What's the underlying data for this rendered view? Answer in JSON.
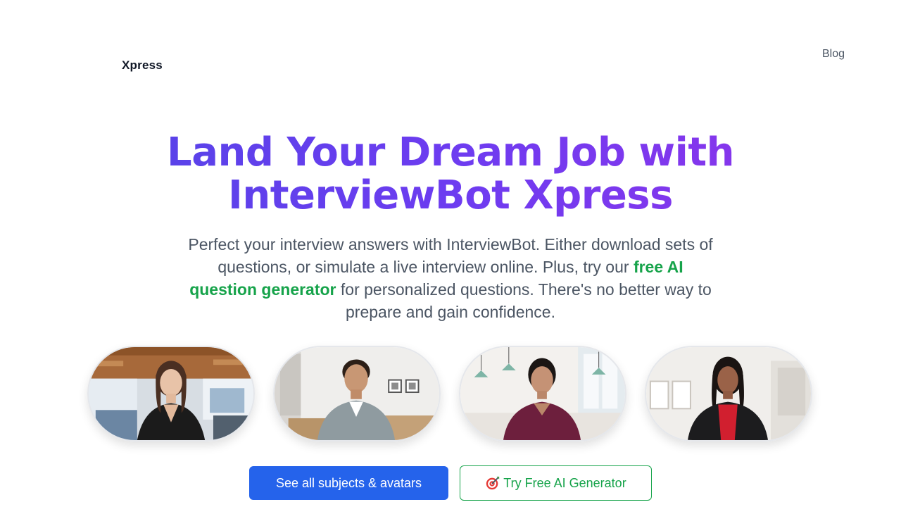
{
  "header": {
    "logo": "Xpress",
    "nav": {
      "blog_label": "Blog"
    }
  },
  "hero": {
    "title_line1": "Land Your Dream Job with",
    "title_line2": "InterviewBot Xpress",
    "subtitle_before": "Perfect your interview answers with InterviewBot. Either download sets of questions, or simulate a live interview online. Plus, try our ",
    "subtitle_link": "free AI question generator",
    "subtitle_after": " for personalized questions. There's no better way to prepare and gain confidence."
  },
  "avatars": [
    {
      "name": "avatar-woman-office"
    },
    {
      "name": "avatar-man-scrubs"
    },
    {
      "name": "avatar-woman-kitchen"
    },
    {
      "name": "avatar-woman-blazer"
    }
  ],
  "actions": {
    "primary_label": "See all subjects & avatars",
    "secondary_label": "Try Free AI Generator",
    "secondary_icon": "target-icon"
  },
  "colors": {
    "title_gradient_start": "#4f46e5",
    "title_gradient_end": "#9333ea",
    "link_green": "#16a34a",
    "primary_blue": "#2563eb",
    "body_text": "#4b5563"
  }
}
